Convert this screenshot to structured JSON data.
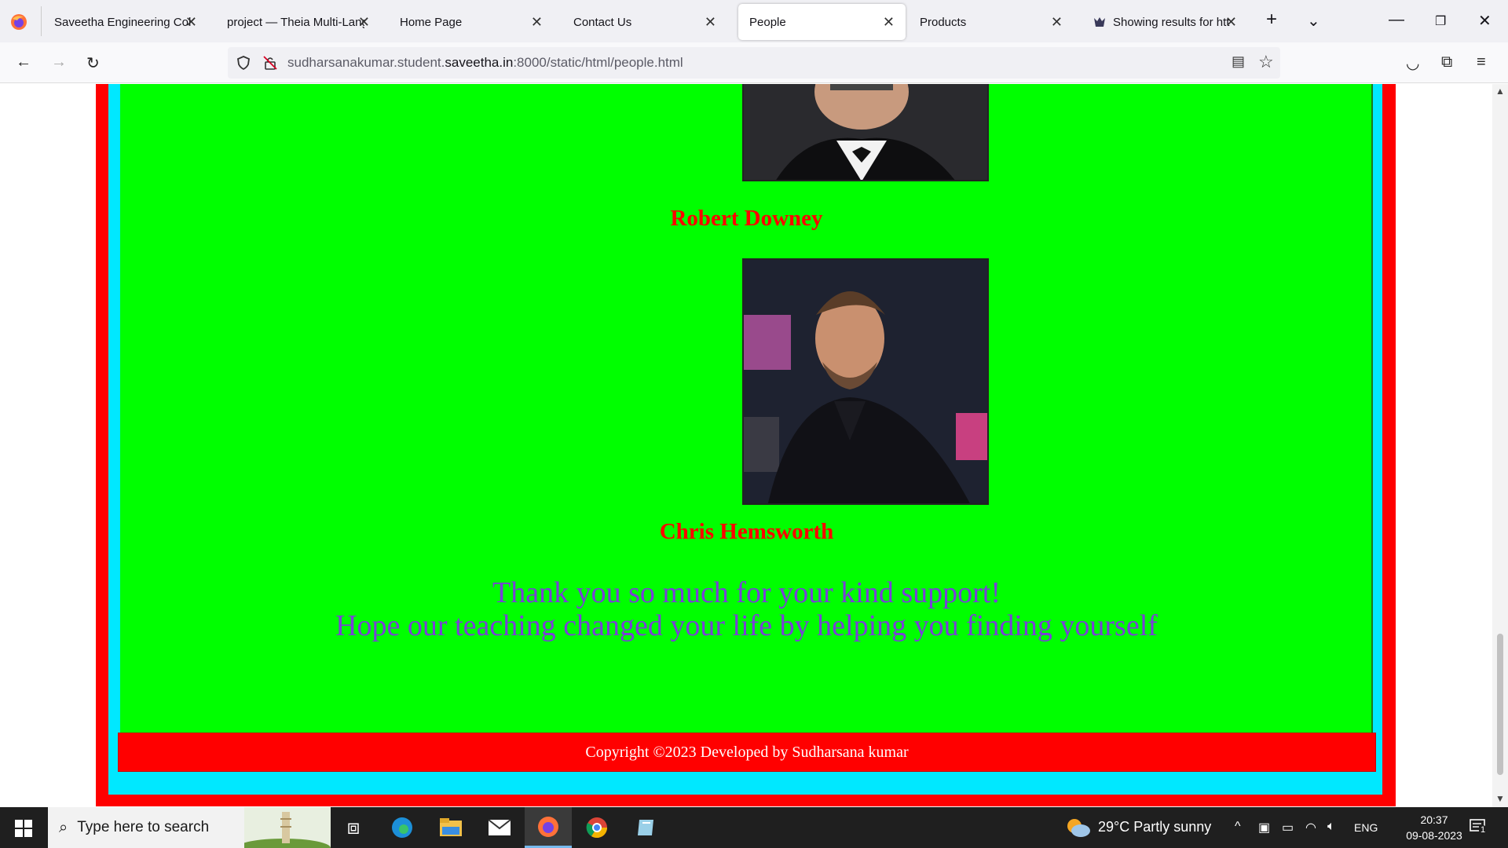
{
  "browser": {
    "tabs": [
      {
        "title": "Saveetha Engineering Colle",
        "active": false
      },
      {
        "title": "project — Theia Multi-Lang",
        "active": false
      },
      {
        "title": "Home Page",
        "active": false
      },
      {
        "title": "Contact Us",
        "active": false
      },
      {
        "title": "People",
        "active": true
      },
      {
        "title": "Products",
        "active": false
      },
      {
        "title": "Showing results for htt",
        "active": false
      }
    ],
    "url_prefix": "sudharsanakumar.student.",
    "url_host": "saveetha.in",
    "url_suffix": ":8000/static/html/people.html"
  },
  "page": {
    "people": [
      {
        "name": "Robert Downey"
      },
      {
        "name": "Chris Hemsworth"
      }
    ],
    "thanks_line1": "Thank you so much for your kind support!",
    "thanks_line2": "Hope our teaching changed your life by helping you finding yourself",
    "footer": "Copyright ©2023 Developed by Sudharsana kumar"
  },
  "taskbar": {
    "search_placeholder": "Type here to search",
    "weather": "29°C  Partly sunny",
    "language": "ENG",
    "time": "20:37",
    "date": "09-08-2023",
    "notification_count": "1"
  },
  "colors": {
    "outer_border": "#ff0000",
    "inner_border": "#00e8ff",
    "content_bg": "#00ff00",
    "name_color": "#ff0000",
    "thanks_color": "#7a3fd8"
  }
}
